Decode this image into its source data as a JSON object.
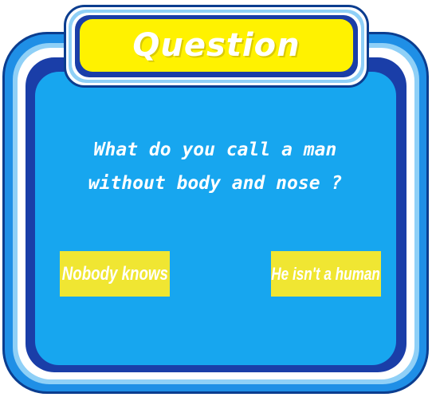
{
  "title": "Question",
  "question": {
    "line1": "What do you call a man",
    "line2": "without body and nose ?"
  },
  "answers": [
    {
      "label": "Nobody knows"
    },
    {
      "label": "He isn't a human"
    }
  ],
  "colors": {
    "panel": "#17a6ef",
    "frame": "#1f8fe6",
    "navy": "#1a3ea8",
    "banner": "#fff200",
    "button": "#f0e632",
    "text": "#ffffff"
  }
}
